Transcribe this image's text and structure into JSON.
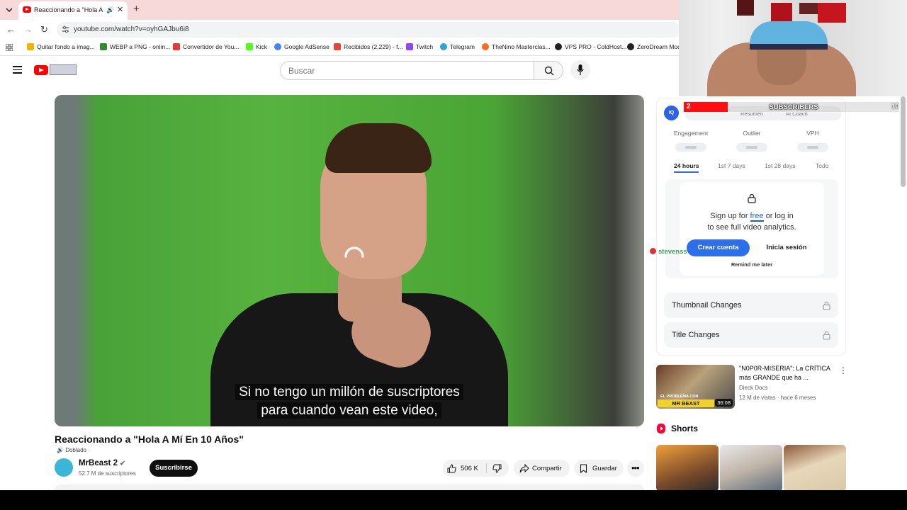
{
  "browser": {
    "tab_title": "Reaccionando a \"Hola A Mí",
    "url": "youtube.com/watch?v=oyhGAJbu6i8",
    "bookmarks": [
      {
        "label": "Quitar fondo a imag...",
        "color": "#f2b400"
      },
      {
        "label": "WEBP a PNG - onlin...",
        "color": "#2f8c2f"
      },
      {
        "label": "Convertidor de You...",
        "color": "#e53935"
      },
      {
        "label": "Kick",
        "color": "#53fc18"
      },
      {
        "label": "Google AdSense",
        "color": "#4285f4"
      },
      {
        "label": "Recibidos (2,229) - f...",
        "color": "#ea4335"
      },
      {
        "label": "Twitch",
        "color": "#9146ff"
      },
      {
        "label": "Telegram",
        "color": "#2aa3df"
      },
      {
        "label": "TheNino Masterclas...",
        "color": "#ff6b1a"
      },
      {
        "label": "VPS PRO - ColdHost...",
        "color": "#222222"
      },
      {
        "label": "ZeroDream Mod",
        "color": "#222222"
      }
    ]
  },
  "youtube": {
    "search_placeholder": "Buscar"
  },
  "video": {
    "subtitle_line1": "Si no tengo un millón de suscriptores",
    "subtitle_line2": "para cuando vean este video,",
    "title": "Reaccionando a \"Hola A Mí En 10 Años\"",
    "dubbed_label": "Doblado",
    "channel_name": "MrBeast 2",
    "channel_subs": "52.7 M de suscriptores",
    "subscribe_label": "Suscribirse",
    "likes": "506 K",
    "share_label": "Compartir",
    "save_label": "Guardar"
  },
  "widget": {
    "logo": "IQ",
    "tab_summary": "Resumen",
    "tab_coach": "AI Coach",
    "metrics": [
      "Engagement",
      "Outlier",
      "VPH"
    ],
    "periods": [
      "24 hours",
      "1st 7 days",
      "1st 28 days",
      "Todo"
    ],
    "active_period": "24 hours",
    "signup_prefix": "Sign up for ",
    "signup_free": "free",
    "signup_suffix": " or log in",
    "signup_line2": "to see full video analytics.",
    "create_account": "Crear cuenta",
    "login": "Inicia sesión",
    "remind_later": "Remind me later",
    "locked_rows": [
      "Thumbnail Changes",
      "Title Changes"
    ],
    "accent_color": "#2c6fe8"
  },
  "recommended": {
    "title": "\"N0P0R-MISERIA\": La CRÍTICA más GRANDE que ha ...",
    "channel": "Dieck Docs",
    "meta": "12 M de vistas · hace 6 meses",
    "duration": "36:08",
    "thumb_caption": "EL PROBLEMA CON",
    "thumb_banner": "MR BEAST"
  },
  "shorts": {
    "heading": "Shorts"
  },
  "stream_overlay": {
    "goal_label": "SUBSCRIBERS",
    "goal_current": "2",
    "goal_target": "10",
    "goal_progress": 0.2,
    "chat_user": "stevenss"
  }
}
